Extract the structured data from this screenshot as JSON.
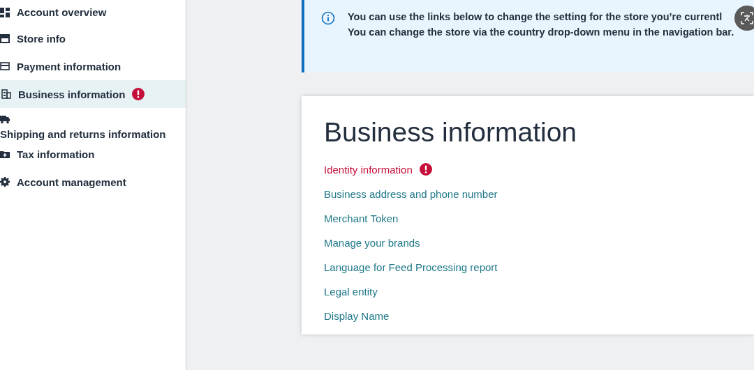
{
  "sidebar": {
    "items": [
      {
        "label": "Account overview",
        "kind": "inline",
        "selected": false,
        "alert": false
      },
      {
        "label": "Store info",
        "kind": "inline",
        "selected": false,
        "alert": false
      },
      {
        "label": "Payment information",
        "kind": "inline",
        "selected": false,
        "alert": false
      },
      {
        "label": "Business information",
        "kind": "inline",
        "selected": true,
        "alert": true
      },
      {
        "label": "Shipping and returns information",
        "kind": "stacked",
        "selected": false,
        "alert": false
      },
      {
        "label": "Tax information",
        "kind": "inline",
        "selected": false,
        "alert": false
      },
      {
        "label": "Account management",
        "kind": "inline",
        "selected": false,
        "alert": false
      }
    ]
  },
  "banner": {
    "lines": [
      "You can use the links below to change the setting for the store you’re currentl",
      "You can change the store via the country drop-down menu in the navigation bar."
    ]
  },
  "card": {
    "title": "Business information",
    "links": [
      {
        "label": "Identity information",
        "alert": true
      },
      {
        "label": "Business address and phone number",
        "alert": false
      },
      {
        "label": "Merchant Token",
        "alert": false
      },
      {
        "label": "Manage your brands",
        "alert": false
      },
      {
        "label": "Language for Feed Processing report",
        "alert": false
      },
      {
        "label": "Legal entity",
        "alert": false
      },
      {
        "label": "Display Name",
        "alert": false
      }
    ]
  }
}
